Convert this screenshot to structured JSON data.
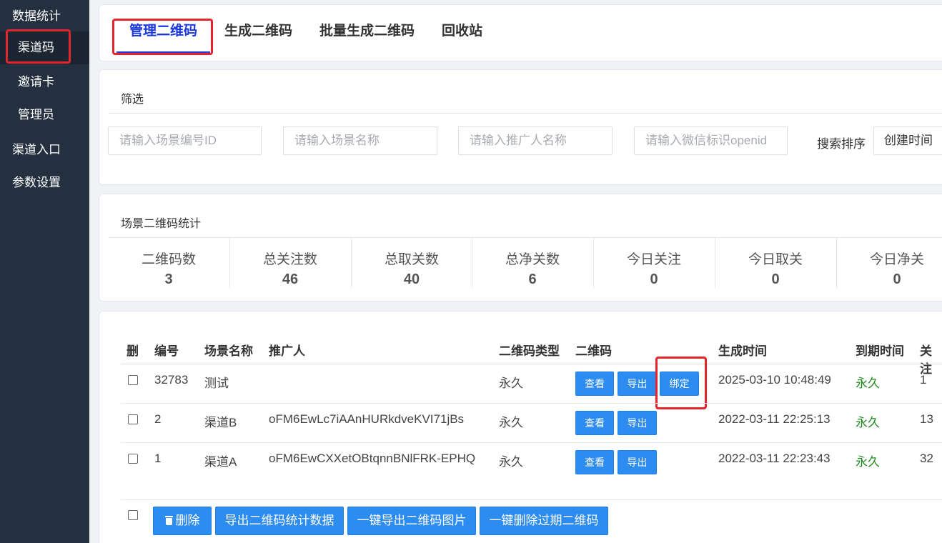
{
  "sidebar": {
    "items": [
      {
        "label": "数据统计"
      },
      {
        "label": "渠道码"
      },
      {
        "label": "邀请卡"
      },
      {
        "label": "管理员"
      },
      {
        "label": "渠道入口"
      },
      {
        "label": "参数设置"
      }
    ]
  },
  "tabs": [
    {
      "label": "管理二维码"
    },
    {
      "label": "生成二维码"
    },
    {
      "label": "批量生成二维码"
    },
    {
      "label": "回收站"
    }
  ],
  "filter": {
    "title": "筛选",
    "scene_id_placeholder": "请输入场景编号ID",
    "scene_name_placeholder": "请输入场景名称",
    "promoter_placeholder": "请输入推广人名称",
    "openid_placeholder": "请输入微信标识openid",
    "sort_label": "搜索排序",
    "sort_value": "创建时间"
  },
  "stats": {
    "title": "场景二维码统计",
    "items": [
      {
        "label": "二维码数",
        "value": "3"
      },
      {
        "label": "总关注数",
        "value": "46"
      },
      {
        "label": "总取关数",
        "value": "40"
      },
      {
        "label": "总净关数",
        "value": "6"
      },
      {
        "label": "今日关注",
        "value": "0"
      },
      {
        "label": "今日取关",
        "value": "0"
      },
      {
        "label": "今日净关",
        "value": "0"
      }
    ]
  },
  "table": {
    "headers": {
      "del": "删",
      "id": "编号",
      "scene_name": "场景名称",
      "promoter": "推广人",
      "qr_type": "二维码类型",
      "qr": "二维码",
      "created": "生成时间",
      "expire": "到期时间",
      "follow": "关注"
    },
    "button_labels": {
      "view": "查看",
      "export": "导出",
      "bind": "绑定"
    },
    "rows": [
      {
        "id": "32783",
        "scene_name": "测试",
        "promoter": "",
        "qr_type": "永久",
        "created": "2025-03-10 10:48:49",
        "expire": "永久",
        "follow": "1"
      },
      {
        "id": "2",
        "scene_name": "渠道B",
        "promoter": "oFM6EwLc7iAAnHURkdveKVI71jBs",
        "qr_type": "永久",
        "created": "2022-03-11 22:25:13",
        "expire": "永久",
        "follow": "13"
      },
      {
        "id": "1",
        "scene_name": "渠道A",
        "promoter": "oFM6EwCXXetOBtqnnBNlFRK-EPHQ",
        "qr_type": "永久",
        "created": "2022-03-11 22:23:43",
        "expire": "永久",
        "follow": "32"
      }
    ]
  },
  "actions": {
    "delete": "删除",
    "export_stats": "导出二维码统计数据",
    "export_images": "一键导出二维码图片",
    "delete_expired": "一键删除过期二维码"
  },
  "colors": {
    "sidebar_bg": "#24303f",
    "accent": "#2d8cf0",
    "tab_active": "#1a37e0",
    "highlight_box": "#e5242b",
    "permanent_text": "#1f8a1f"
  }
}
